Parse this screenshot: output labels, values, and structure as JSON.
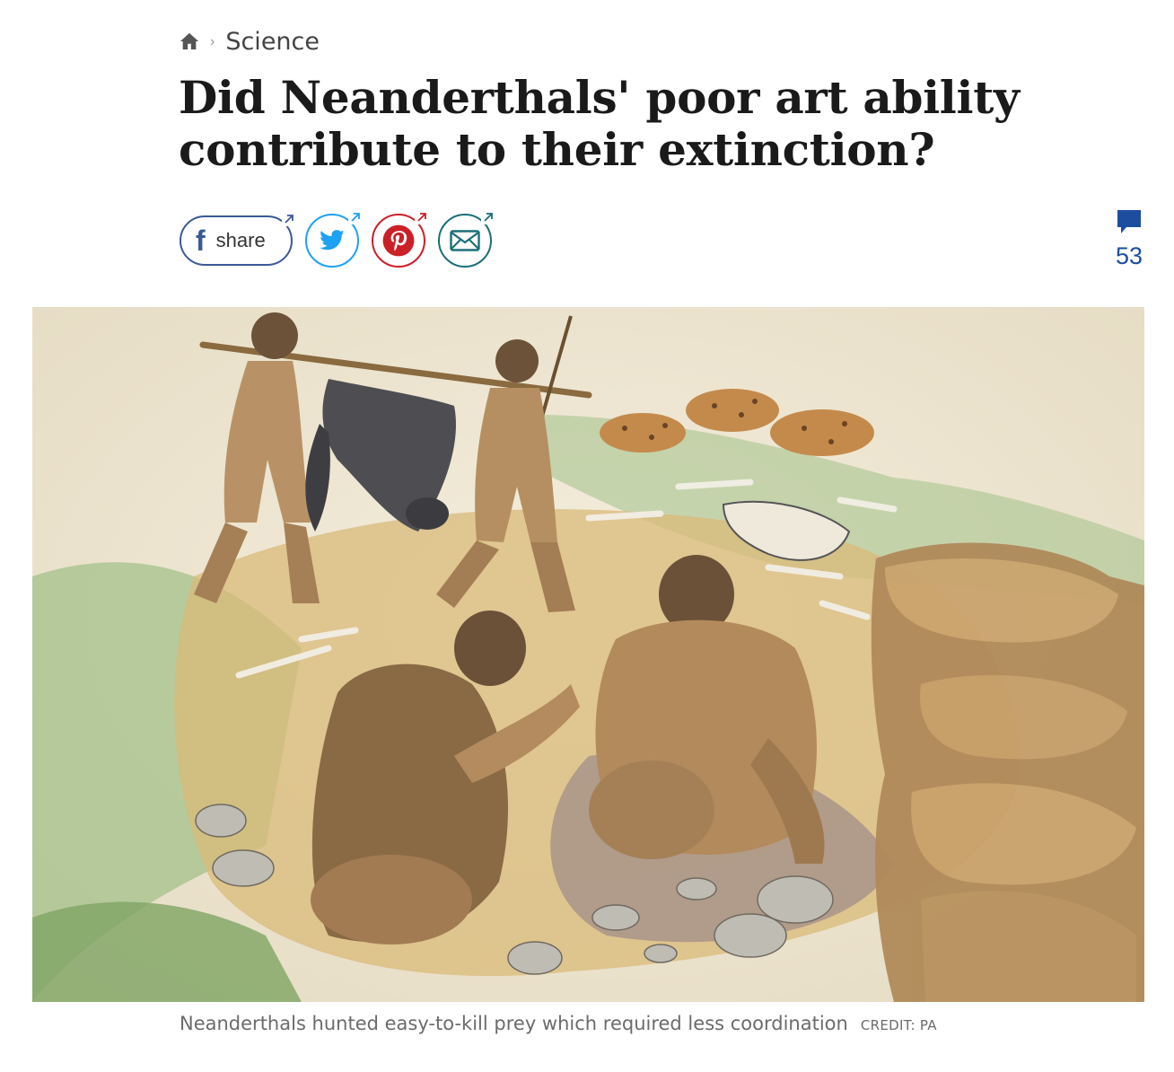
{
  "breadcrumb": {
    "home_icon": "home-icon",
    "separator": "›",
    "section": "Science"
  },
  "headline": "Did Neanderthals' poor art ability contribute to their extinction?",
  "share": {
    "facebook_label": "share",
    "icons": [
      "facebook-icon",
      "twitter-icon",
      "pinterest-icon",
      "mail-icon"
    ],
    "colors": {
      "facebook": "#3b5998",
      "twitter": "#1da1f2",
      "pinterest": "#cb2027",
      "mail": "#1b6f78"
    }
  },
  "comments": {
    "icon": "comment-icon",
    "count": "53",
    "color": "#1d4d9f"
  },
  "image": {
    "description_icon": "illustration"
  },
  "caption": {
    "text": "Neanderthals hunted easy-to-kill prey which required less coordination",
    "credit": "CREDIT: PA"
  }
}
